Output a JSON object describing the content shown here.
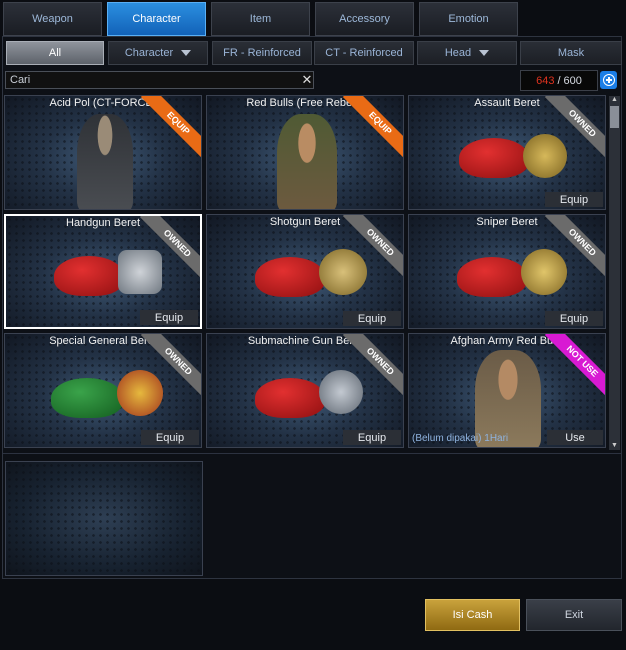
{
  "tabs": [
    "Weapon",
    "Character",
    "Item",
    "Accessory",
    "Emotion"
  ],
  "active_tab": "Character",
  "filters": [
    {
      "label": "All",
      "dropdown": false
    },
    {
      "label": "Character",
      "dropdown": true
    },
    {
      "label": "FR - Reinforced",
      "dropdown": false
    },
    {
      "label": "CT - Reinforced",
      "dropdown": false
    },
    {
      "label": "Head",
      "dropdown": true
    },
    {
      "label": "Mask",
      "dropdown": false
    }
  ],
  "search": {
    "value": "Cari"
  },
  "capacity": {
    "used": "643",
    "total": "/ 600"
  },
  "items": [
    {
      "title": "Acid Pol (CT-FORCE)",
      "status": "EQUIP",
      "action": "",
      "note": ""
    },
    {
      "title": "Red Bulls (Free Rebels)",
      "status": "EQUIP",
      "action": "",
      "note": ""
    },
    {
      "title": "Assault Beret",
      "status": "OWNED",
      "action": "Equip",
      "note": ""
    },
    {
      "title": "Handgun Beret",
      "status": "OWNED",
      "action": "Equip",
      "note": ""
    },
    {
      "title": "Shotgun Beret",
      "status": "OWNED",
      "action": "Equip",
      "note": ""
    },
    {
      "title": "Sniper Beret",
      "status": "OWNED",
      "action": "Equip",
      "note": ""
    },
    {
      "title": "Special General Beret",
      "status": "OWNED",
      "action": "Equip",
      "note": ""
    },
    {
      "title": "Submachine Gun Beret",
      "status": "OWNED",
      "action": "Equip",
      "note": ""
    },
    {
      "title": "Afghan Army Red Bulls",
      "status": "NOT USE",
      "action": "Use",
      "note": "(Belum dipakai) 1Hari"
    }
  ],
  "selected_item": "Handgun Beret",
  "buttons": {
    "cash": "Isi Cash",
    "exit": "Exit"
  },
  "colors": {
    "accent": "#1b7ee6",
    "equip_ribbon": "#e96b15",
    "owned_ribbon": "#6b6b6b",
    "notuse_ribbon": "#d81ad3",
    "capacity_used": "#e0321e"
  }
}
